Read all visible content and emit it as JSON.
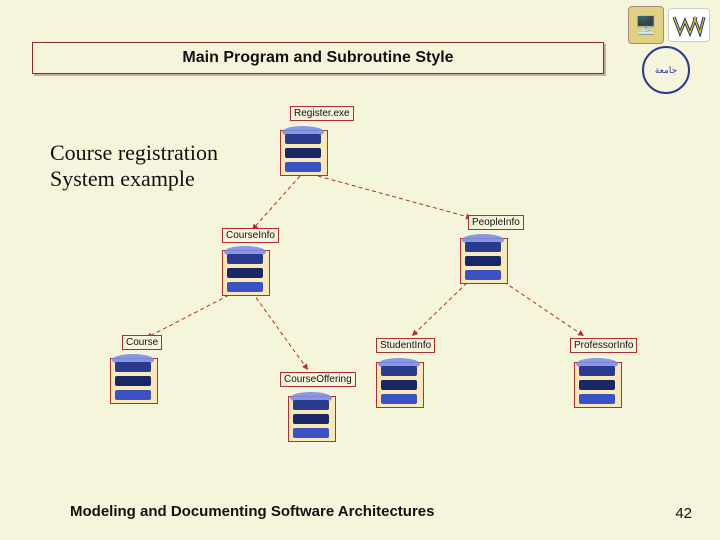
{
  "title": "Main Program and Subroutine Style",
  "subtitle_line1": "Course registration",
  "subtitle_line2": "System example",
  "footer": "Modeling and Documenting Software Architectures",
  "slide_number": "42",
  "nodes": {
    "register": "Register.exe",
    "people": "PeopleInfo",
    "courseinfo": "CourseInfo",
    "course": "Course",
    "student": "StudentInfo",
    "professor": "ProfessorInfo",
    "offering": "CourseOffering"
  },
  "logos": {
    "desk_emoji": "🖥️",
    "wv_text": "WV",
    "seal_text": "جامعة"
  },
  "chart_data": {
    "type": "diagram",
    "title": "Main Program and Subroutine Style — Course Registration System example",
    "nodes": [
      {
        "id": "Register.exe",
        "role": "main-program"
      },
      {
        "id": "CourseInfo",
        "role": "subroutine"
      },
      {
        "id": "PeopleInfo",
        "role": "subroutine"
      },
      {
        "id": "Course",
        "role": "subroutine"
      },
      {
        "id": "CourseOffering",
        "role": "subroutine"
      },
      {
        "id": "StudentInfo",
        "role": "subroutine"
      },
      {
        "id": "ProfessorInfo",
        "role": "subroutine"
      }
    ],
    "edges": [
      {
        "from": "Register.exe",
        "to": "CourseInfo",
        "style": "dashed"
      },
      {
        "from": "Register.exe",
        "to": "PeopleInfo",
        "style": "dashed"
      },
      {
        "from": "CourseInfo",
        "to": "Course",
        "style": "dashed"
      },
      {
        "from": "CourseInfo",
        "to": "CourseOffering",
        "style": "dashed"
      },
      {
        "from": "PeopleInfo",
        "to": "StudentInfo",
        "style": "dashed"
      },
      {
        "from": "PeopleInfo",
        "to": "ProfessorInfo",
        "style": "dashed"
      }
    ]
  }
}
